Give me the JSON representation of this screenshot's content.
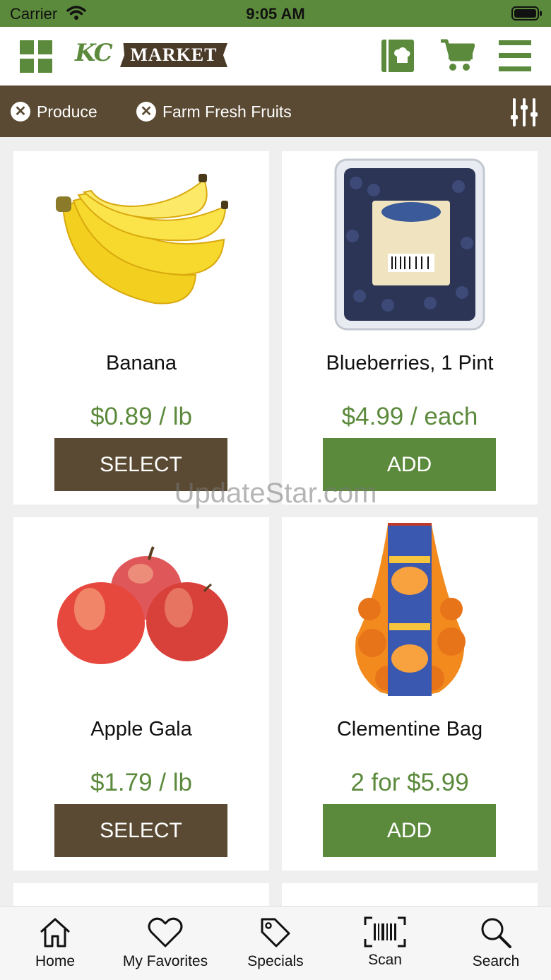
{
  "status": {
    "carrier": "Carrier",
    "time": "9:05 AM"
  },
  "header": {
    "logo_kc": "KC",
    "logo_market": "MARKET",
    "colors": {
      "green": "#5c8a3c",
      "brown": "#5a4a33"
    }
  },
  "filters": {
    "chips": [
      {
        "label": "Produce"
      },
      {
        "label": "Farm Fresh Fruits"
      }
    ]
  },
  "products": [
    {
      "name": "Banana",
      "price": "$0.89 / lb",
      "action": "SELECT",
      "image": "banana-image"
    },
    {
      "name": "Blueberries, 1 Pint",
      "price": "$4.99 / each",
      "action": "ADD",
      "image": "blueberries-image"
    },
    {
      "name": "Apple Gala",
      "price": "$1.79 / lb",
      "action": "SELECT",
      "image": "apple-image"
    },
    {
      "name": "Clementine Bag",
      "price": "2 for $5.99",
      "action": "ADD",
      "image": "clementine-image"
    }
  ],
  "watermark": "UpdateStar.com",
  "tabs": [
    {
      "label": "Home",
      "icon": "home-icon"
    },
    {
      "label": "My Favorites",
      "icon": "heart-icon"
    },
    {
      "label": "Specials",
      "icon": "tag-icon"
    },
    {
      "label": "Scan",
      "icon": "barcode-icon"
    },
    {
      "label": "Search",
      "icon": "search-icon"
    }
  ]
}
